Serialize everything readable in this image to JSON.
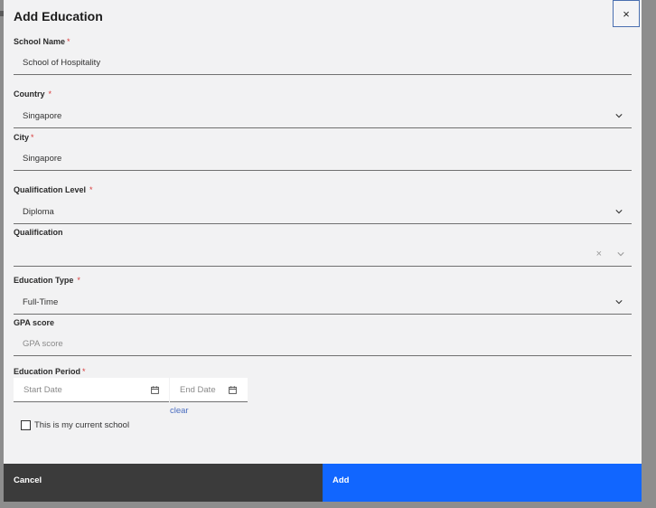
{
  "dialog": {
    "title": "Add Education",
    "close_label": "×"
  },
  "form": {
    "required_mark": "*",
    "school_name": {
      "label": "School Name",
      "value": "School of Hospitality"
    },
    "country": {
      "label": "Country",
      "value": "Singapore",
      "icon": "chevron-down-icon"
    },
    "city": {
      "label": "City",
      "value": "Singapore"
    },
    "qualification_level": {
      "label": "Qualification Level",
      "value": "Diploma",
      "icon": "chevron-down-icon"
    },
    "qualification": {
      "label": "Qualification",
      "value": "",
      "clear_glyph": "×",
      "icon": "chevron-down-icon"
    },
    "education_type": {
      "label": "Education Type",
      "value": "Full-Time",
      "icon": "chevron-down-icon"
    },
    "gpa": {
      "label": "GPA score",
      "placeholder": "GPA score"
    },
    "education_period": {
      "label": "Education Period",
      "start_placeholder": "Start Date",
      "end_placeholder": "End Date",
      "icon": "calendar-icon",
      "clear_label": "clear"
    },
    "current_school": {
      "label": "This is my current school",
      "checked": false
    }
  },
  "footer": {
    "cancel_label": "Cancel",
    "add_label": "Add"
  },
  "colors": {
    "accent": "#1166ff",
    "cancel_bg": "#3b3b3b",
    "required": "#d83b3b",
    "link": "#4a6dbf"
  }
}
